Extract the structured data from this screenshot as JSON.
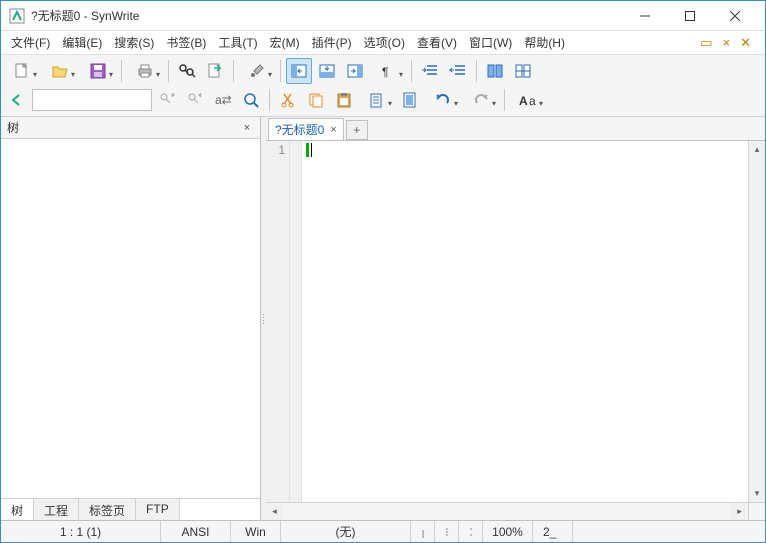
{
  "window": {
    "title": "?无标题0 - SynWrite"
  },
  "menu": {
    "items": [
      "文件(F)",
      "编辑(E)",
      "搜索(S)",
      "书签(B)",
      "工具(T)",
      "宏(M)",
      "插件(P)",
      "选项(O)",
      "查看(V)",
      "窗口(W)",
      "帮助(H)"
    ]
  },
  "sidebar": {
    "title": "树",
    "tabs": [
      "树",
      "工程",
      "标签页",
      "FTP"
    ]
  },
  "editor": {
    "tab_label": "?无标题0",
    "line_number": "1"
  },
  "status": {
    "pos": "1 : 1 (1)",
    "enc": "ANSI",
    "eol": "Win",
    "lang": "(无)",
    "zoom": "100%",
    "tab": "2_"
  }
}
